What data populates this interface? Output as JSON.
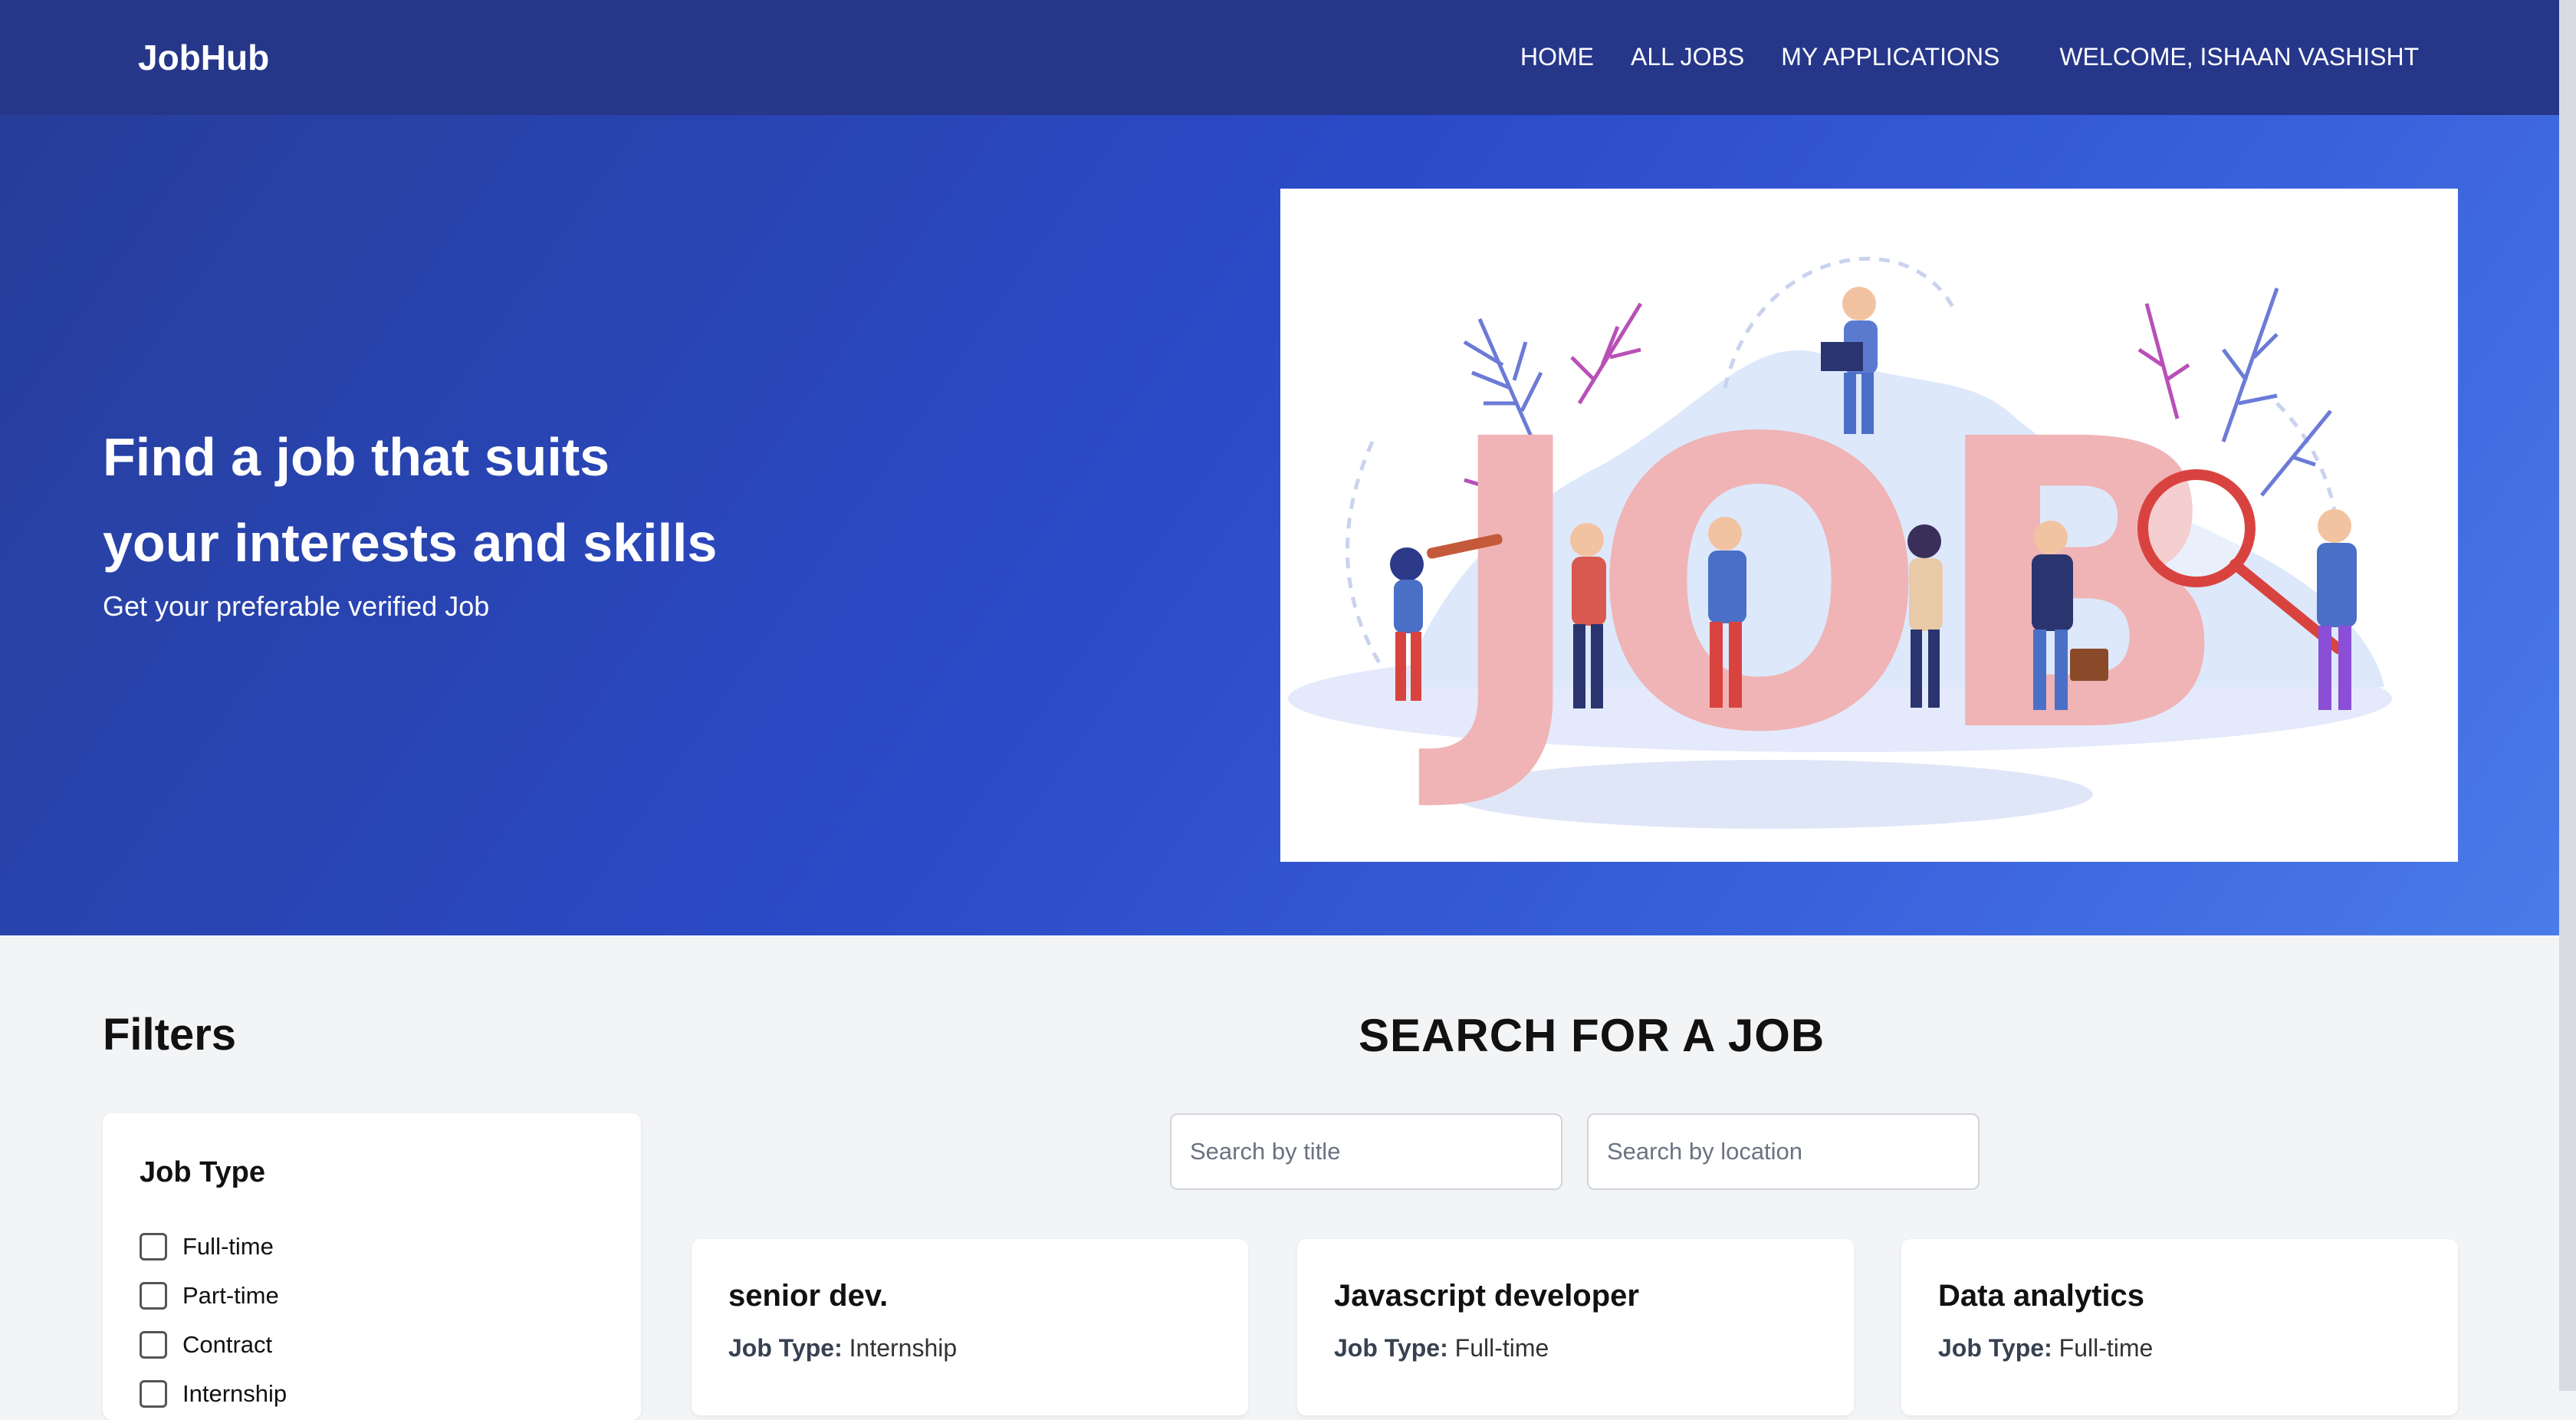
{
  "nav": {
    "logo": "JobHub",
    "links": [
      "HOME",
      "ALL JOBS",
      "MY APPLICATIONS"
    ],
    "welcome": "WELCOME, ISHAAN VASHISHT"
  },
  "hero": {
    "title_line1": "Find a job that suits",
    "title_line2": "your interests and skills",
    "subtitle": "Get your preferable verified Job",
    "illustration_word": "JOB"
  },
  "filters": {
    "title": "Filters",
    "job_type_heading": "Job Type",
    "options": [
      "Full-time",
      "Part-time",
      "Contract",
      "Internship"
    ]
  },
  "search": {
    "title": "SEARCH FOR A JOB",
    "title_placeholder": "Search by title",
    "location_placeholder": "Search by location"
  },
  "jobs": [
    {
      "title": "senior dev.",
      "type_label": "Job Type:",
      "type": "Internship"
    },
    {
      "title": "Javascript developer",
      "type_label": "Job Type:",
      "type": "Full-time"
    },
    {
      "title": "Data analytics",
      "type_label": "Job Type:",
      "type": "Full-time"
    }
  ],
  "colors": {
    "navbar": "#26378a",
    "hero_gradient_start": "#263e99",
    "hero_gradient_end": "#4a7be8",
    "page_background": "#f3f4f6"
  }
}
